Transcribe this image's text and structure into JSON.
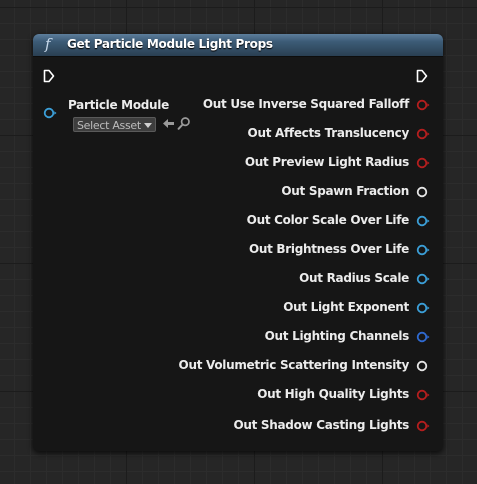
{
  "node": {
    "title": "Get Particle Module Light Props",
    "function_icon": "f",
    "header_color": "#3c5b76",
    "input": {
      "label": "Particle Module",
      "asset_picker": "Select Asset",
      "pin_color": "#3b9fd8"
    },
    "outputs": [
      {
        "label": "Out Use Inverse Squared Falloff",
        "pin_type": "bool",
        "color": "#b51e1e"
      },
      {
        "label": "Out Affects Translucency",
        "pin_type": "bool",
        "color": "#b51e1e"
      },
      {
        "label": "Out Preview Light Radius",
        "pin_type": "bool",
        "color": "#b51e1e"
      },
      {
        "label": "Out Spawn Fraction",
        "pin_type": "wildcard",
        "color": "#e6e6e6"
      },
      {
        "label": "Out Color Scale Over Life",
        "pin_type": "object",
        "color": "#3b9fd8"
      },
      {
        "label": "Out Brightness Over Life",
        "pin_type": "object",
        "color": "#3b9fd8"
      },
      {
        "label": "Out Radius Scale",
        "pin_type": "object",
        "color": "#3b9fd8"
      },
      {
        "label": "Out Light Exponent",
        "pin_type": "object",
        "color": "#3b9fd8"
      },
      {
        "label": "Out Lighting Channels",
        "pin_type": "struct",
        "color": "#2f6ad1"
      },
      {
        "label": "Out Volumetric Scattering Intensity",
        "pin_type": "wildcard",
        "color": "#e6e6e6"
      },
      {
        "label": "Out High Quality Lights",
        "pin_type": "bool",
        "color": "#b51e1e"
      },
      {
        "label": "Out Shadow Casting Lights",
        "pin_type": "bool",
        "color": "#b51e1e"
      }
    ]
  }
}
